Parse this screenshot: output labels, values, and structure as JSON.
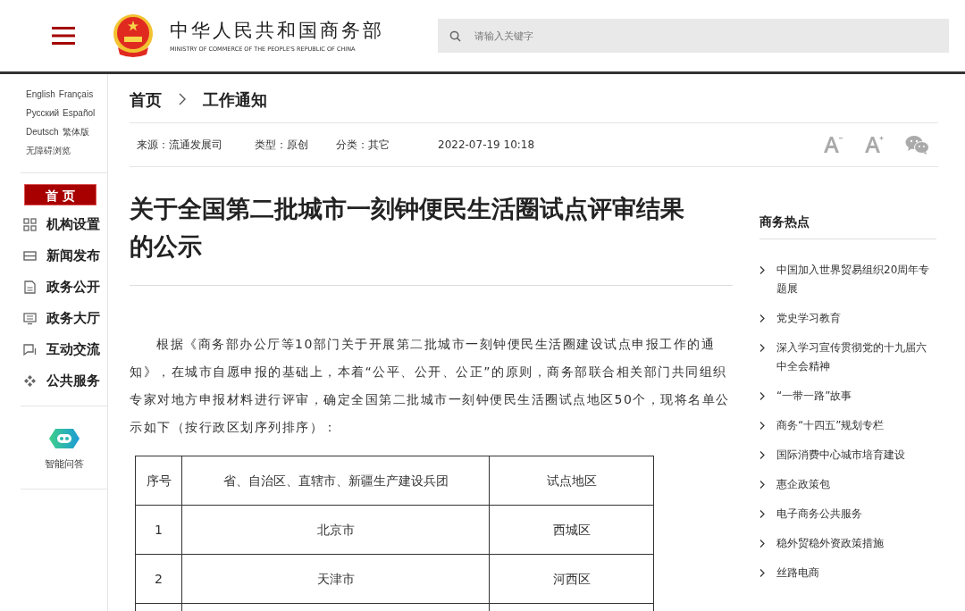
{
  "header": {
    "title": "中华人民共和国商务部",
    "subtitle": "MINISTRY OF COMMERCE OF THE PEOPLE'S REPUBLIC OF CHINA",
    "search": {
      "placeholder": "请输入关键字"
    }
  },
  "sidebar": {
    "languages": [
      "English",
      "Français",
      "Русский",
      "Español",
      "Deutsch",
      "繁体版",
      "无障碍浏览"
    ],
    "home": "首 页",
    "items": [
      {
        "label": "机构设置",
        "kind": "grid"
      },
      {
        "label": "新闻发布",
        "kind": "news"
      },
      {
        "label": "政务公开",
        "kind": "doc"
      },
      {
        "label": "政务大厅",
        "kind": "screen"
      },
      {
        "label": "互动交流",
        "kind": "chat"
      },
      {
        "label": "公共服务",
        "kind": "service"
      }
    ],
    "assistant": "智能问答"
  },
  "breadcrumb": [
    "首页",
    "工作通知"
  ],
  "meta": [
    "来源：流通发展司",
    "类型：原创",
    "分类：其它",
    "2022-07-19 10:18"
  ],
  "article": {
    "title": "关于全国第二批城市一刻钟便民生活圈试点评审结果的公示",
    "paragraph": "根据《商务部办公厅等10部门关于开展第二批城市一刻钟便民生活圈建设试点申报工作的通知》，在城市自愿申报的基础上，本着“公平、公开、公正”的原则，商务部联合相关部门共同组织专家对地方申报材料进行评审，确定全国第二批城市一刻钟便民生活圈试点地区50个，现将名单公示如下（按行政区划序列排序）：",
    "table": {
      "columns": [
        "序号",
        "省、自治区、直辖市、新疆生产建设兵团",
        "试点地区"
      ],
      "rows": [
        [
          "1",
          "北京市",
          "西城区"
        ],
        [
          "2",
          "天津市",
          "河西区"
        ]
      ]
    }
  },
  "hot": {
    "title": "商务热点",
    "items": [
      "中国加入世界贸易组织20周年专题展",
      "党史学习教育",
      "深入学习宣传贯彻党的十九届六中全会精神",
      "“一带一路”故事",
      "商务“十四五”规划专栏",
      "国际消费中心城市培育建设",
      "惠企政策包",
      "电子商务公共服务",
      "稳外贸稳外资政策措施",
      "丝路电商"
    ]
  }
}
